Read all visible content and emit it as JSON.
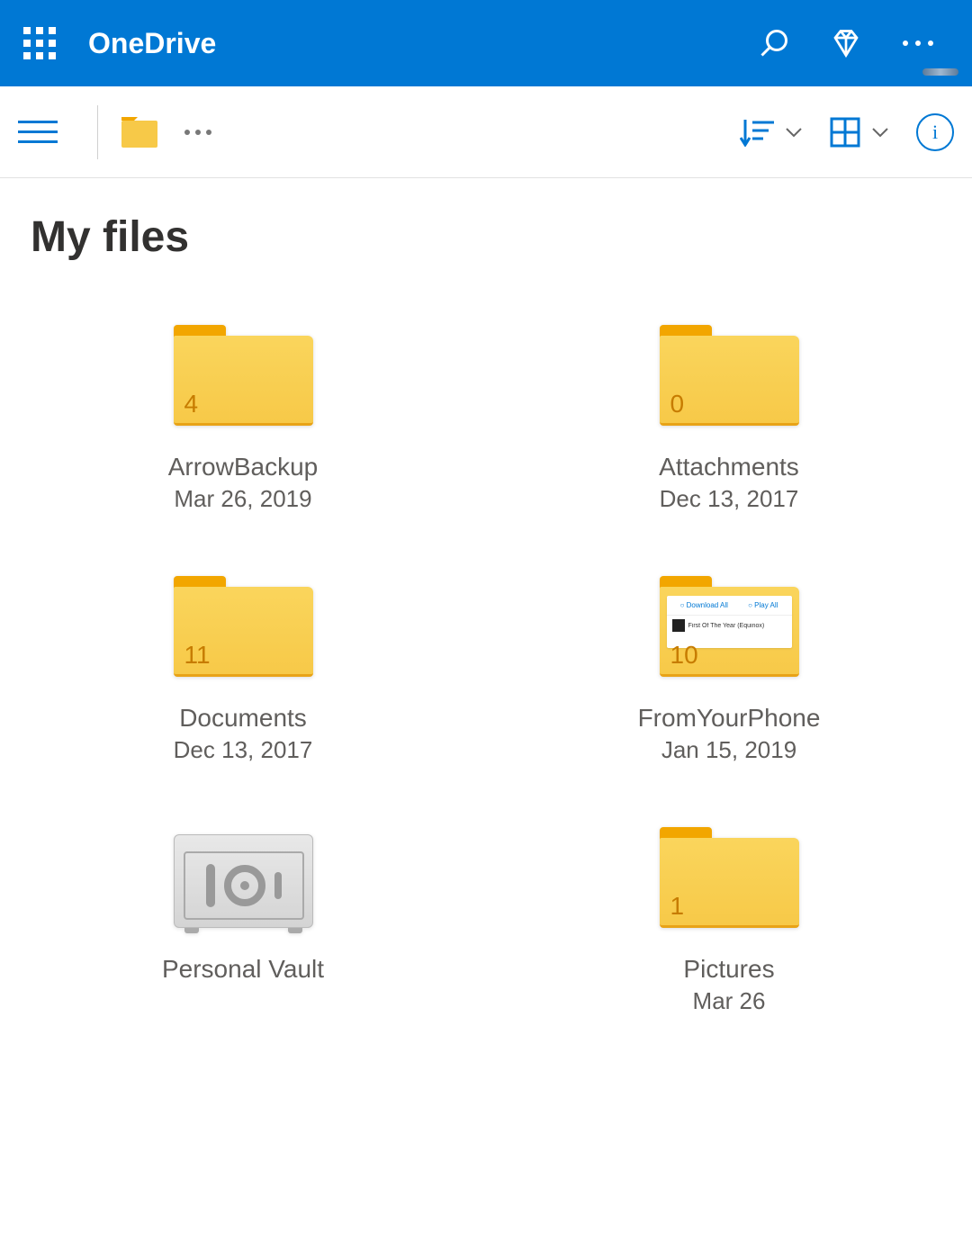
{
  "header": {
    "app_title": "OneDrive"
  },
  "page": {
    "title": "My files"
  },
  "items": [
    {
      "name": "ArrowBackup",
      "date": "Mar 26, 2019",
      "count": "4",
      "type": "folder"
    },
    {
      "name": "Attachments",
      "date": "Dec 13, 2017",
      "count": "0",
      "type": "folder"
    },
    {
      "name": "Documents",
      "date": "Dec 13, 2017",
      "count": "11",
      "type": "folder"
    },
    {
      "name": "FromYourPhone",
      "date": "Jan 15, 2019",
      "count": "10",
      "type": "folder-preview"
    },
    {
      "name": "Personal Vault",
      "date": "",
      "count": "",
      "type": "vault"
    },
    {
      "name": "Pictures",
      "date": "Mar 26",
      "count": "1",
      "type": "folder"
    }
  ],
  "preview": {
    "download": "Download All",
    "play": "Play All",
    "track": "First Of The Year (Equinox)"
  }
}
